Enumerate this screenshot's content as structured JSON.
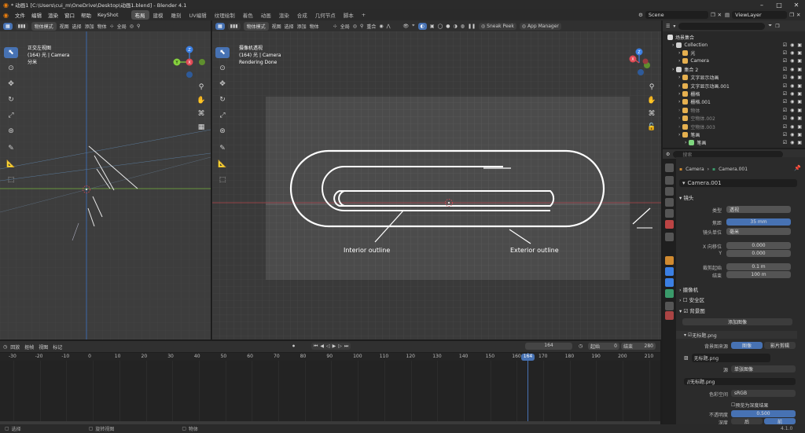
{
  "window": {
    "title": "* 动画1 [C:\\Users\\cui_m\\OneDrive\\Desktop\\动画1.blend] - Blender 4.1",
    "minimize_icon": "minimize-icon",
    "maximize_icon": "maximize-icon",
    "close_icon": "close-icon"
  },
  "menubar": {
    "items": [
      "文件",
      "编辑",
      "渲染",
      "窗口",
      "帮助",
      "KeyShot"
    ],
    "workspaces": [
      "布局",
      "建模",
      "雕刻",
      "UV编辑",
      "纹理绘制",
      "着色",
      "动画",
      "渲染",
      "合成",
      "几何节点",
      "脚本"
    ],
    "active_workspace": "布局",
    "add_tab": "+",
    "scene_label": "Scene",
    "viewlayer_label": "ViewLayer"
  },
  "left_view": {
    "header": {
      "mode": "物体模式",
      "menus": [
        "视图",
        "选择",
        "添加",
        "物体"
      ],
      "transform": "全局",
      "options": "选项"
    },
    "overlay": {
      "view_name": "正交左视图",
      "collection": "(164) 光 | Camera",
      "unit": "分米"
    },
    "gizmo": {
      "z": "Z",
      "y": "Y",
      "x": "X"
    }
  },
  "camera_view": {
    "header": {
      "mode": "物体模式",
      "menus": [
        "视图",
        "选择",
        "添加",
        "物体"
      ],
      "transform": "全局",
      "snap": "重合",
      "sneak_peek": "Sneak Peek",
      "app_manager": "App Manager",
      "options": "选项"
    },
    "overlay": {
      "view_name": "摄像机透视",
      "collection": "(164) 光 | Camera",
      "status": "Rendering Done"
    },
    "labels": {
      "interior": "Interior outline",
      "exterior": "Exterior outline"
    },
    "gizmo": {
      "z": "Z",
      "x": "X"
    }
  },
  "outliner": {
    "title": "场景集合",
    "rows": [
      {
        "label": "Collection",
        "indent": 1,
        "color": "#e6e6e6",
        "dim": false
      },
      {
        "label": "光",
        "indent": 2,
        "color": "#e6b04f",
        "dim": false
      },
      {
        "label": "Camera",
        "indent": 2,
        "color": "#e6b04f",
        "dim": false
      },
      {
        "label": "集合 2",
        "indent": 1,
        "color": "#e6e6e6",
        "dim": false
      },
      {
        "label": "文字显示动画",
        "indent": 2,
        "color": "#e6b04f",
        "dim": false
      },
      {
        "label": "文字显示动画.001",
        "indent": 2,
        "color": "#e6b04f",
        "dim": false
      },
      {
        "label": "栅格",
        "indent": 2,
        "color": "#e6b04f",
        "dim": false
      },
      {
        "label": "栅格.001",
        "indent": 2,
        "color": "#e6b04f",
        "dim": false
      },
      {
        "label": "物体",
        "indent": 2,
        "color": "#e6b04f",
        "dim": true
      },
      {
        "label": "空物体.002",
        "indent": 2,
        "color": "#e6b04f",
        "dim": true
      },
      {
        "label": "空物体.003",
        "indent": 2,
        "color": "#e6b04f",
        "dim": true
      },
      {
        "label": "笔画",
        "indent": 2,
        "color": "#e6b04f",
        "dim": false
      },
      {
        "label": "笔画",
        "indent": 3,
        "color": "#7fd77f",
        "dim": false
      }
    ]
  },
  "properties": {
    "search_placeholder": "搜索",
    "breadcrumb": [
      "Camera",
      "Camera.001"
    ],
    "data_name": "Camera.001",
    "lens_section": "镜头",
    "type_label": "类型",
    "type_value": "透视",
    "focal_label": "焦距",
    "focal_value": "35 mm",
    "unit_label": "镜头单位",
    "unit_value": "毫米",
    "shift_x_label": "X 向移位",
    "shift_x_value": "0.000",
    "shift_y_label": "Y",
    "shift_y_value": "0.000",
    "clip_start_label": "裁剪起始",
    "clip_start_value": "0.1 m",
    "clip_end_label": "结束",
    "clip_end_value": "100 m",
    "camera_section": "摄像机",
    "safe_section": "安全区",
    "bg_section": "背景图",
    "add_image": "添加图像",
    "image_name": "无标题.png",
    "source_label": "背景图来源",
    "source_image": "图像",
    "source_clip": "影片剪辑",
    "image_file": "无标题.png",
    "open_label": "源",
    "single_image": "单张图像",
    "filepath": "//无标题.png",
    "colorspace_label": "色彩空间",
    "colorspace_value": "sRGB",
    "premult_label": "预览为深度结果",
    "opacity_label": "不透明度",
    "opacity_value": "0.500",
    "depth_label": "深度",
    "depth_back": "后",
    "depth_front": "前"
  },
  "timeline": {
    "menus": [
      "回放",
      "抠帧",
      "视图",
      "标记"
    ],
    "current_frame": "164",
    "start_label": "起始",
    "start_value": "0",
    "end_label": "结束",
    "end_value": "280",
    "ticks": [
      "-30",
      "-20",
      "-10",
      "0",
      "10",
      "20",
      "30",
      "40",
      "50",
      "60",
      "70",
      "80",
      "90",
      "100",
      "110",
      "120",
      "130",
      "140",
      "150",
      "160",
      "170",
      "180",
      "190",
      "200",
      "210"
    ],
    "playhead": "164"
  },
  "status": {
    "select": "选择",
    "rotate": "旋转视图",
    "object": "物体",
    "version": "4.1.0"
  },
  "colors": {
    "accent": "#4772b3",
    "header": "#303030",
    "viewport": "#3d3d3d",
    "grid_bg": "#4a4a4a",
    "x_axis": "#e04a55",
    "y_axis": "#85d13d",
    "z_axis": "#3b7fe3"
  }
}
